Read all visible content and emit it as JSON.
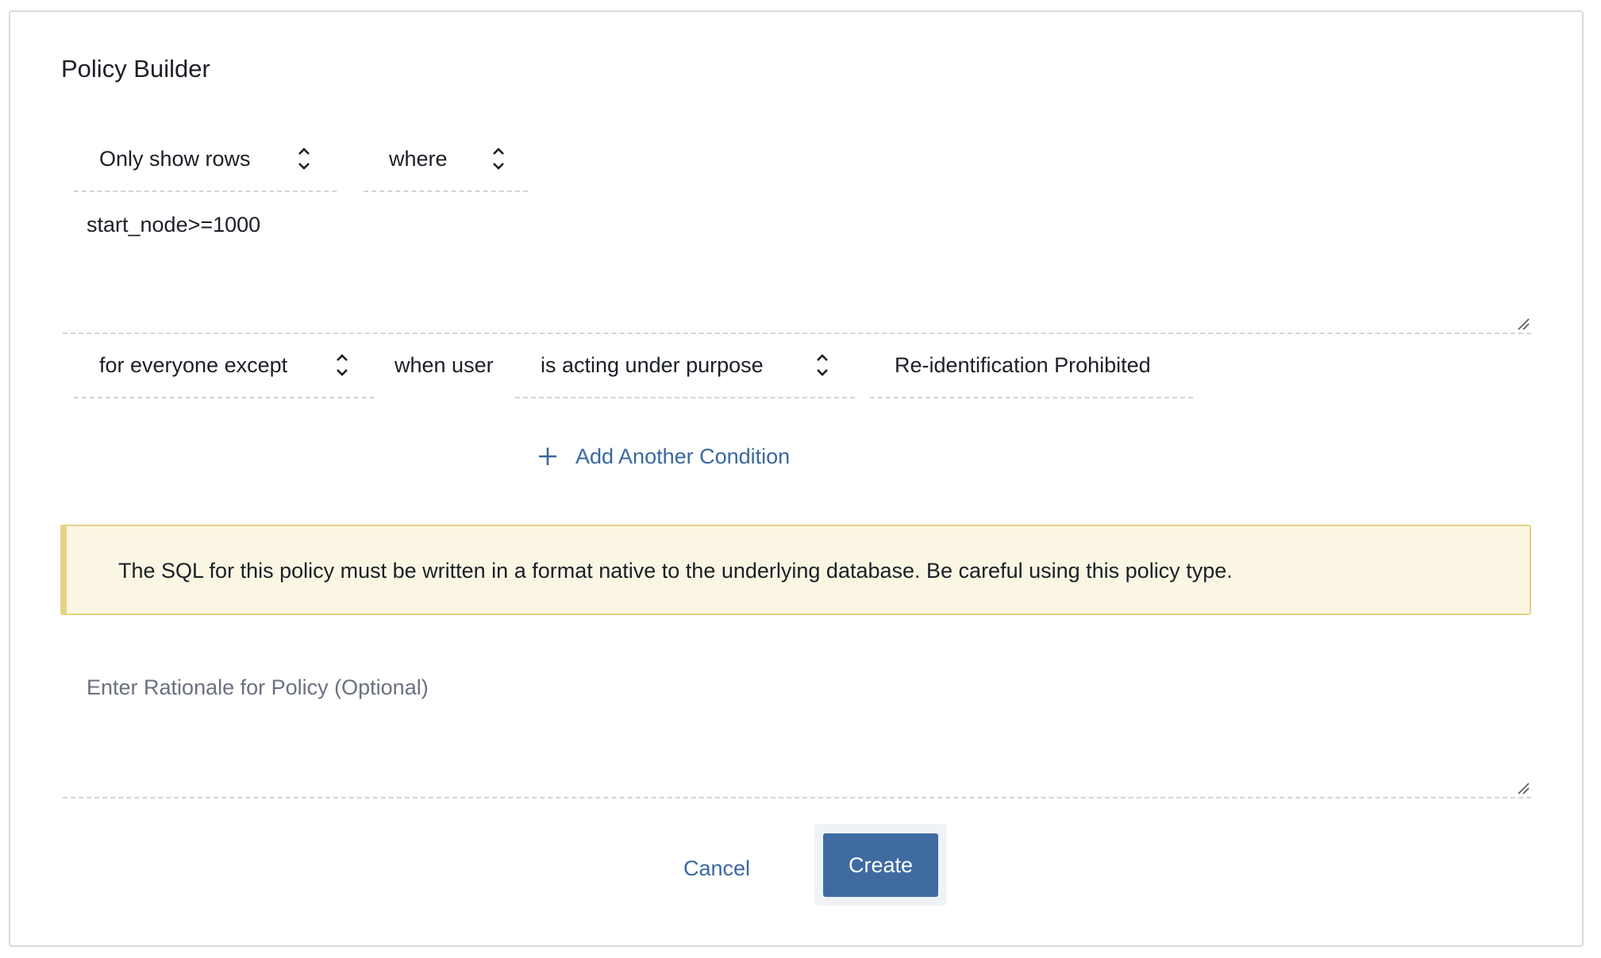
{
  "title": "Policy Builder",
  "row1": {
    "action_select": {
      "value": "Only show rows",
      "icon": "chevron-up-down-icon"
    },
    "condition_select": {
      "value": "where",
      "icon": "chevron-up-down-icon"
    }
  },
  "sql_textarea": {
    "value": "start_node>=1000",
    "icon": "resize-handle-icon"
  },
  "row2": {
    "scope_select": {
      "value": "for everyone except",
      "icon": "chevron-up-down-icon"
    },
    "when_user_label": "when user",
    "operator_select": {
      "value": "is acting under purpose",
      "icon": "chevron-up-down-icon"
    },
    "purpose_input": {
      "value": "Re-identification Prohibited"
    }
  },
  "add_condition": {
    "label": "Add Another Condition",
    "icon": "plus-icon"
  },
  "warning": {
    "text": "The SQL for this policy must be written in a format native to the underlying database. Be careful using this policy type."
  },
  "rationale_textarea": {
    "placeholder": "Enter Rationale for Policy (Optional)",
    "value": "",
    "icon": "resize-handle-icon"
  },
  "actions": {
    "cancel_label": "Cancel",
    "create_label": "Create"
  },
  "colors": {
    "accent": "#3f6ba1",
    "link": "#3a67a1",
    "warning_bg": "#faf6e3",
    "warning_border": "#e6d384",
    "text": "#1b1f26",
    "placeholder": "#6b7080"
  }
}
